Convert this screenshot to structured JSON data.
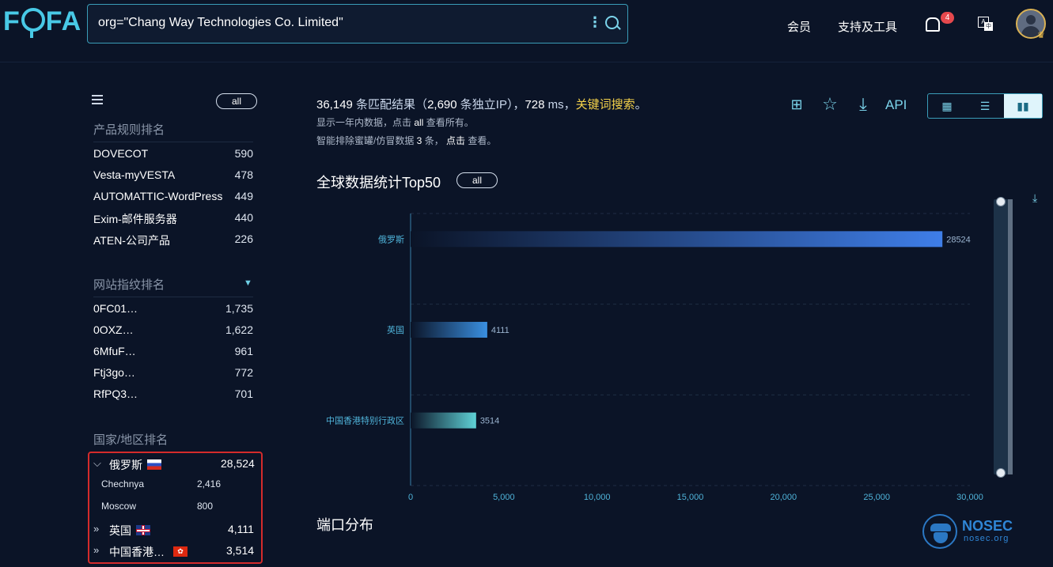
{
  "header": {
    "logo": "FOFA",
    "query": "org=\"Chang Way Technologies Co. Limited\"",
    "nav": [
      "会员",
      "支持及工具"
    ],
    "notification_count": "4",
    "translate_glyph_a": "A",
    "translate_glyph_b": "中"
  },
  "sidebar": {
    "all_label": "all",
    "product_title": "产品规则排名",
    "products": [
      {
        "name": "DOVECOT",
        "count": "590"
      },
      {
        "name": "Vesta-myVESTA",
        "count": "478"
      },
      {
        "name": "AUTOMATTIC-WordPress",
        "count": "449"
      },
      {
        "name": "Exim-邮件服务器",
        "count": "440"
      },
      {
        "name": "ATEN-公司产品",
        "count": "226"
      }
    ],
    "fingerprint_title": "网站指纹排名",
    "fingerprints": [
      {
        "name": "0FC01…",
        "count": "1,735"
      },
      {
        "name": "0OXZ…",
        "count": "1,622"
      },
      {
        "name": "6MfuF…",
        "count": "961"
      },
      {
        "name": "Ftj3go…",
        "count": "772"
      },
      {
        "name": "RfPQ3…",
        "count": "701"
      }
    ],
    "country_title": "国家/地区排名",
    "countries": [
      {
        "name": "俄罗斯",
        "count": "28,524",
        "children": [
          {
            "name": "Chechnya",
            "count": "2,416"
          },
          {
            "name": "Moscow",
            "count": "800"
          }
        ]
      },
      {
        "name": "英国",
        "count": "4,111"
      },
      {
        "name": "中国香港…",
        "count": "3,514"
      }
    ],
    "hk_flag_glyph": "✿"
  },
  "summary": {
    "matches": "36,149",
    "matches_suffix": " 条匹配结果（",
    "unique_ip": "2,690",
    "unique_ip_suffix": " 条独立IP），",
    "time": "728",
    "time_unit": " ms，",
    "keyword": "关键词搜索",
    "end": "。",
    "note1_pre": "显示一年内数据，点击 ",
    "note1_link": "all",
    "note1_post": " 查看所有。",
    "note2_pre": "智能排除蜜罐/仿冒数据 ",
    "note2_count": "3",
    "note2_mid": " 条， ",
    "note2_link": "点击",
    "note2_post": " 查看。"
  },
  "toolbar": {
    "api_label": "API",
    "icons": [
      "grid-compare-icon",
      "star-icon",
      "download-icon"
    ]
  },
  "stats": {
    "title": "全球数据统计Top50",
    "all_label": "all",
    "port_title": "端口分布"
  },
  "chart_data": {
    "type": "bar",
    "orientation": "horizontal",
    "categories": [
      "俄罗斯",
      "英国",
      "中国香港特别行政区"
    ],
    "values": [
      28524,
      4111,
      3514
    ],
    "xlim": [
      0,
      30000
    ],
    "xticks": [
      0,
      5000,
      10000,
      15000,
      20000,
      25000,
      30000
    ],
    "xtick_labels": [
      "0",
      "5,000",
      "10,000",
      "15,000",
      "20,000",
      "25,000",
      "30,000"
    ],
    "colors": [
      "#3f7ee8",
      "#3a8fe0",
      "#5fd1d6"
    ],
    "grid": true
  },
  "watermark": {
    "name": "NOSEC",
    "domain": "nosec.org"
  }
}
